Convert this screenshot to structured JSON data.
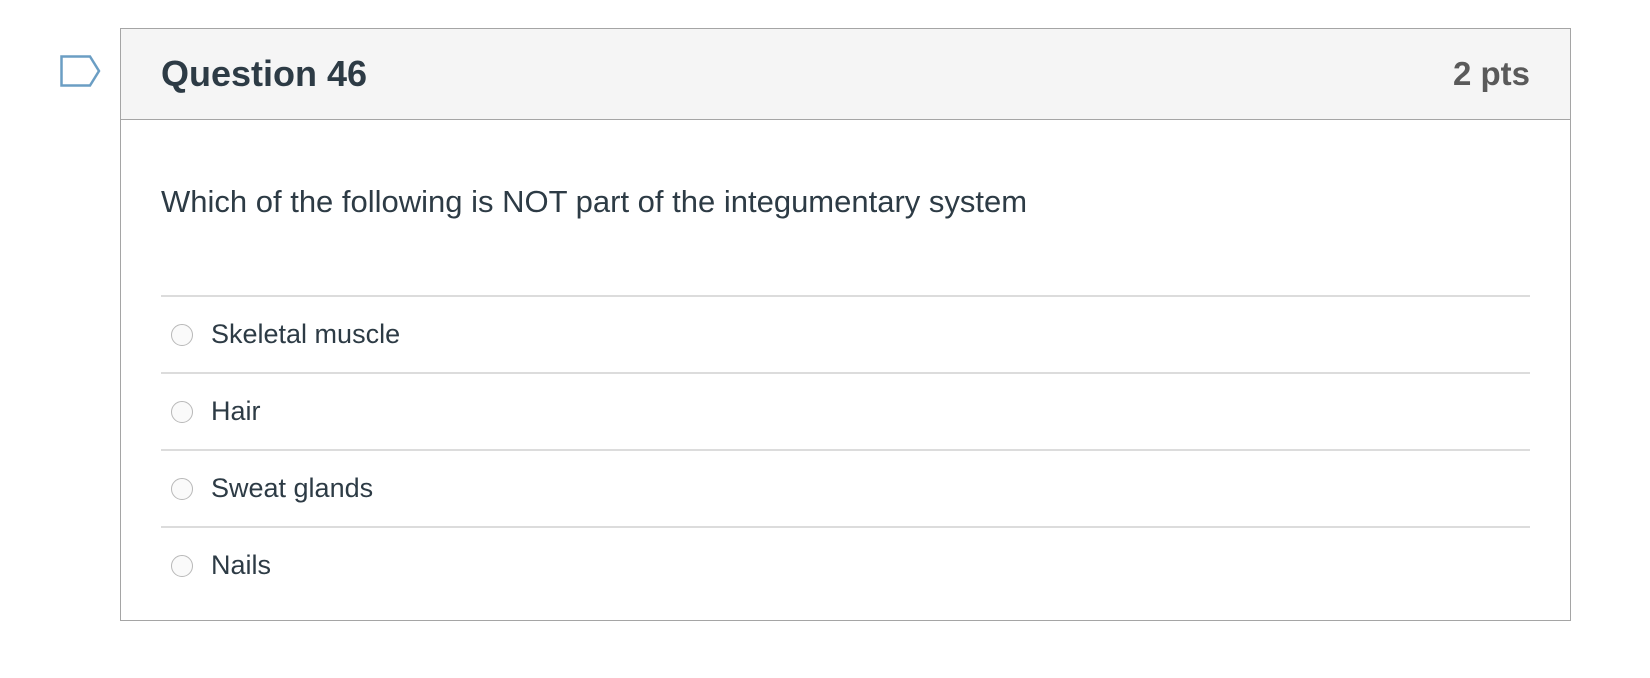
{
  "question": {
    "title": "Question 46",
    "points": "2 pts",
    "flag_icon": "bookmark-flag-icon",
    "text": "Which of the following is NOT part of the integumentary system",
    "answers": [
      {
        "label": "Skeletal muscle",
        "selected": false
      },
      {
        "label": "Hair",
        "selected": false
      },
      {
        "label": "Sweat glands",
        "selected": false
      },
      {
        "label": "Nails",
        "selected": false
      }
    ]
  },
  "colors": {
    "text": "#2d3b45",
    "header_bg": "#f5f5f5",
    "border": "#a5a5a5",
    "flag": "#6b9ec4"
  }
}
